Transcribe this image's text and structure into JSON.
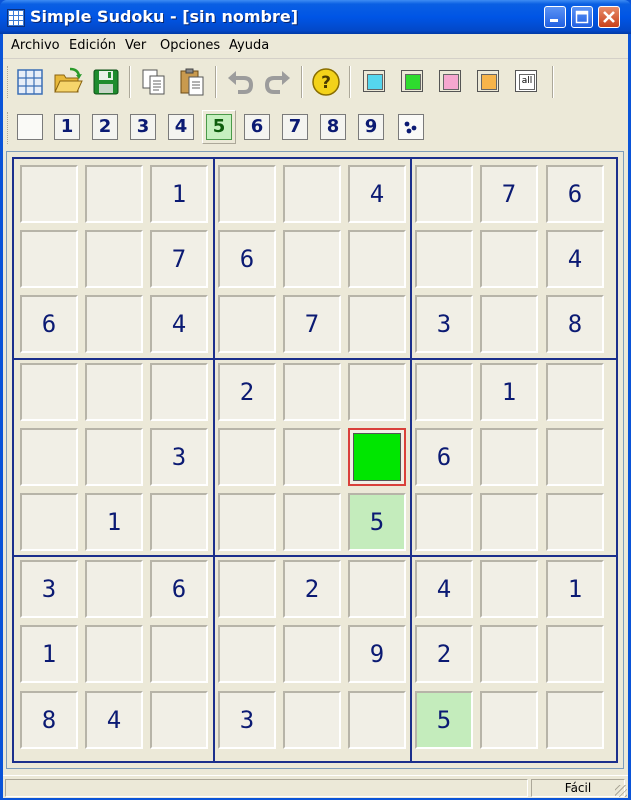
{
  "window": {
    "title": "Simple Sudoku - [sin nombre]",
    "icon": "sudoku-grid-icon"
  },
  "menu": [
    "Archivo",
    "Edición",
    "Ver",
    "Opciones",
    "Ayuda"
  ],
  "toolbar": {
    "tools": [
      "new-grid-icon",
      "open-folder-icon",
      "save-disk-icon",
      "copy-icon",
      "paste-icon",
      "undo-icon",
      "redo-icon",
      "help-icon"
    ],
    "colors": [
      {
        "name": "cyan-swatch",
        "color": "#55d6ee"
      },
      {
        "name": "green-swatch",
        "color": "#2edb2e"
      },
      {
        "name": "pink-swatch",
        "color": "#f6a7cf"
      },
      {
        "name": "orange-swatch",
        "color": "#f7b44a"
      }
    ],
    "all_label": "all"
  },
  "number_bar": {
    "numbers": [
      "1",
      "2",
      "3",
      "4",
      "5",
      "6",
      "7",
      "8",
      "9"
    ],
    "active": "5"
  },
  "colors": {
    "digit": "#0b1a73",
    "box_lines": "#1b2f8c",
    "highlight": "#c4ecbc",
    "selected_mark": "#00e600",
    "selected_border": "#d9403a"
  },
  "board": [
    [
      "",
      "",
      "1",
      "",
      "",
      "4",
      "",
      "7",
      "6"
    ],
    [
      "",
      "",
      "7",
      "6",
      "",
      "",
      "",
      "",
      "4"
    ],
    [
      "6",
      "",
      "4",
      "",
      "7",
      "",
      "3",
      "",
      "8"
    ],
    [
      "",
      "",
      "",
      "2",
      "",
      "",
      "",
      "1",
      ""
    ],
    [
      "",
      "",
      "3",
      "",
      "",
      "",
      "6",
      "",
      ""
    ],
    [
      "",
      "1",
      "",
      "",
      "",
      "5",
      "",
      "",
      ""
    ],
    [
      "3",
      "",
      "6",
      "",
      "2",
      "",
      "4",
      "",
      "1"
    ],
    [
      "1",
      "",
      "",
      "",
      "",
      "9",
      "2",
      "",
      ""
    ],
    [
      "8",
      "4",
      "",
      "3",
      "",
      "",
      "5",
      "",
      ""
    ]
  ],
  "highlighted_value": "5",
  "selected_cell": {
    "row": 4,
    "col": 5
  },
  "status": {
    "left": "",
    "level": "Fácil"
  }
}
